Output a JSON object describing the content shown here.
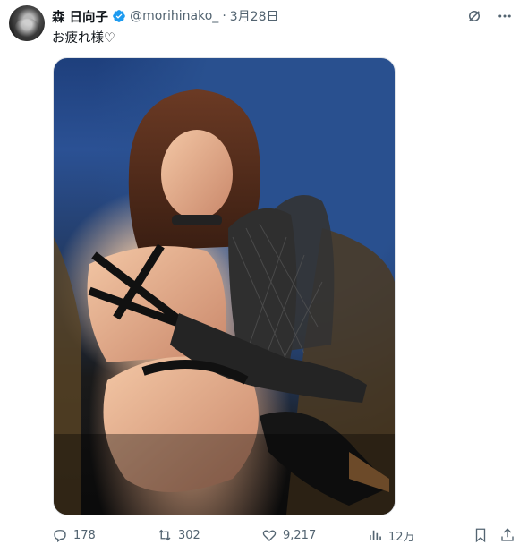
{
  "tweet": {
    "author_name": "森 日向子",
    "handle": "@morihinako_",
    "separator": "·",
    "date": "3月28日",
    "text": "お疲れ様♡"
  },
  "top_actions": {
    "icons": [
      "grok-icon",
      "more-icon"
    ]
  },
  "media": {
    "type": "photo",
    "description_icon": "photo"
  },
  "actions": {
    "replies": "178",
    "retweets": "302",
    "likes": "9,217",
    "views": "12万"
  },
  "colors": {
    "verified": "#1d9bf0",
    "secondary_text": "#536471",
    "text": "#0f1419"
  }
}
